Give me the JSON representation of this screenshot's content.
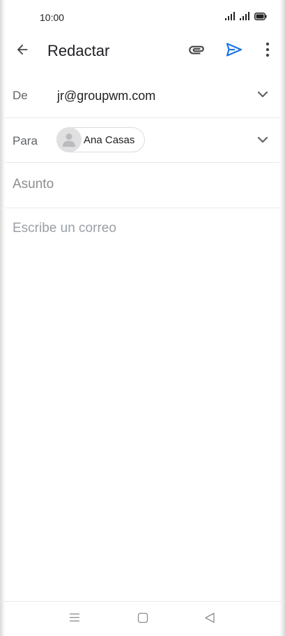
{
  "status_bar": {
    "time": "10:00",
    "icons": [
      "signal-icon",
      "signal-icon",
      "battery-icon"
    ]
  },
  "app_bar": {
    "title": "Redactar",
    "icons": {
      "back": "arrow-back-icon",
      "attach": "paperclip-icon",
      "send": "send-icon",
      "more": "more-vert-icon"
    }
  },
  "compose": {
    "from_label": "De",
    "from_value": "jr@groupwm.com",
    "to_label": "Para",
    "recipients": [
      {
        "name": "Ana Casas",
        "avatar": "person-icon"
      }
    ],
    "subject_placeholder": "Asunto",
    "subject_value": "",
    "body_placeholder": "Escribe un correo",
    "body_value": ""
  },
  "nav_bar": {
    "icons": [
      "menu-icon",
      "home-square-icon",
      "back-triangle-icon"
    ]
  },
  "colors": {
    "accent": "#1a73e8",
    "text_primary": "#202124",
    "text_secondary": "#5f6368",
    "divider": "#e8eaed",
    "chip_border": "#dadce0"
  }
}
